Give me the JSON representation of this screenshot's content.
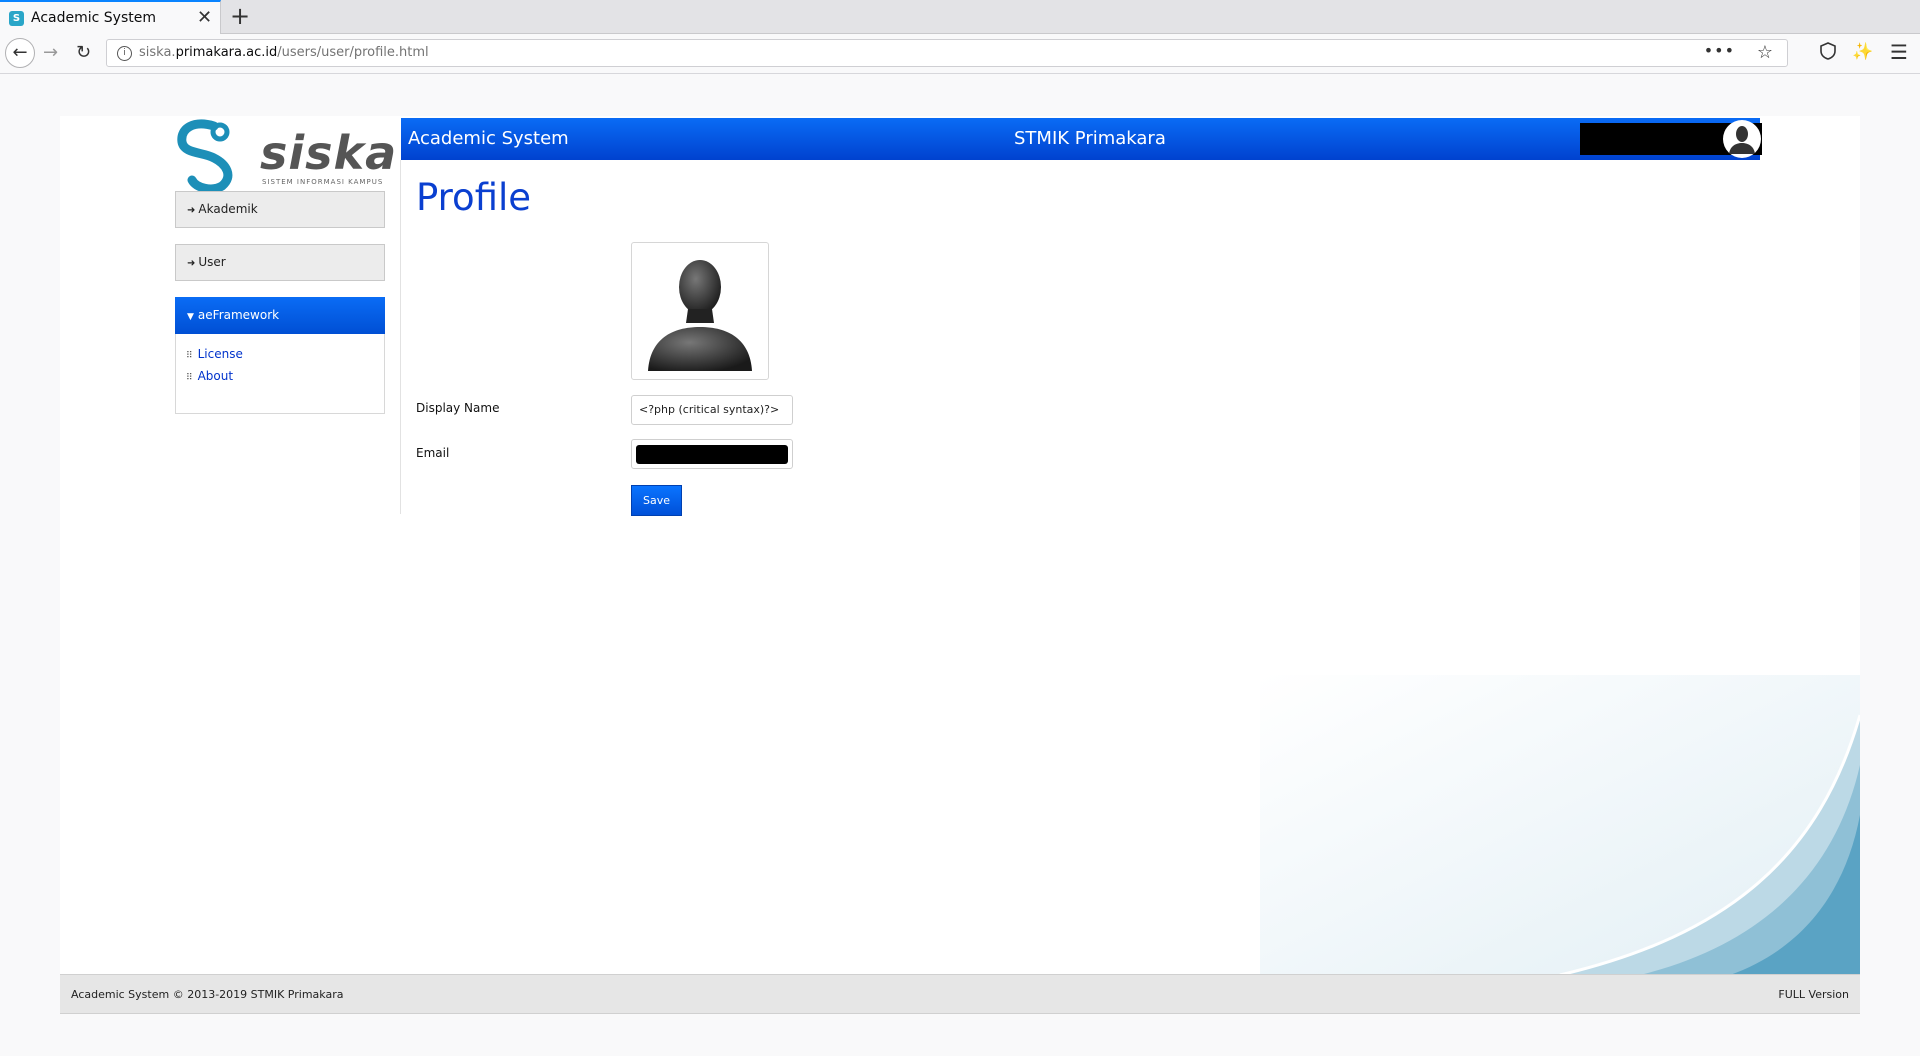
{
  "browser": {
    "tab_title": "Academic System",
    "url_prefix": "siska.",
    "url_domain": "primakara.ac.id",
    "url_path": "/users/user/profile.html",
    "favicon_glyph": "S"
  },
  "logo": {
    "text": "siska",
    "tagline": "SISTEM INFORMASI KAMPUS"
  },
  "sidebar": {
    "items": [
      {
        "label": "Akademik"
      },
      {
        "label": "User"
      }
    ],
    "active": {
      "label": "aeFramework",
      "children": [
        {
          "label": "License"
        },
        {
          "label": "About"
        }
      ]
    }
  },
  "header": {
    "app_name": "Academic System",
    "institution": "STMIK Primakara"
  },
  "main": {
    "title": "Profile",
    "display_name_label": "Display Name",
    "display_name_value": "<?php (critical syntax)?>",
    "email_label": "Email",
    "save_label": "Save"
  },
  "footer": {
    "left": "Academic System © 2013-2019 STMIK Primakara",
    "right": "FULL Version"
  },
  "colors": {
    "accent": "#0a5ff0",
    "title": "#0a3fd0",
    "link": "#0033cc"
  }
}
